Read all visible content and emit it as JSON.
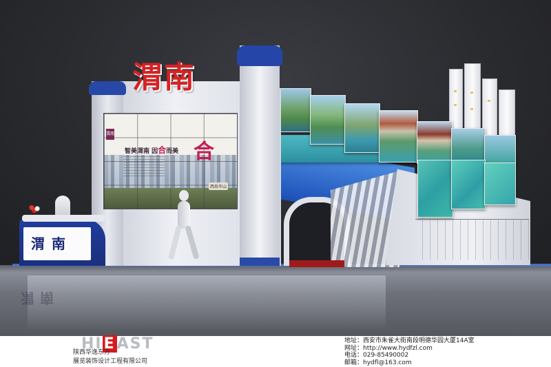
{
  "booth": {
    "logo_word": "渭南",
    "desk_text": "渭南",
    "reflection_text": "渭南"
  },
  "screen": {
    "mini_logo": "渭南",
    "slogan_part1": "智美渭南  因",
    "slogan_he": "合",
    "slogan_part2": "而美",
    "big_char": "合",
    "tag": "西岳华山"
  },
  "footer": {
    "brand_pre": "HI",
    "brand_e": "E",
    "brand_post": "AST",
    "company_line1": "陕西华逸东方",
    "company_line2": "展览装饰设计工程有限公司",
    "address": "地址：西安市朱雀大街南段明德华园大厦14A室",
    "website": "网址：http://www.hydfzl.com",
    "phone": "电话：029-85490002",
    "email": "邮箱：hydfl@163.com"
  }
}
